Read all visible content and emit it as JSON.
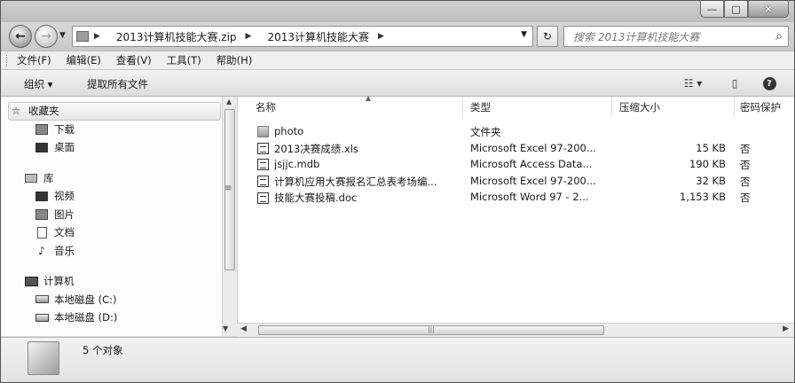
{
  "window": {
    "controls": {
      "minimize": "—",
      "maximize": "□",
      "close": "✕"
    }
  },
  "address": {
    "crumbs": [
      "2013计算机技能大赛.zip",
      "2013计算机技能大赛"
    ],
    "search_placeholder": "搜索 2013计算机技能大赛"
  },
  "menu": [
    "文件(F)",
    "编辑(E)",
    "查看(V)",
    "工具(T)",
    "帮助(H)"
  ],
  "toolbar": {
    "organize": "组织 ▾",
    "extract": "提取所有文件",
    "icons": [
      "view-options-icon",
      "preview-pane-icon",
      "help-icon"
    ]
  },
  "navigation": {
    "favorites": {
      "label": "收藏夹",
      "items": [
        "下载",
        "桌面"
      ]
    },
    "libraries": {
      "label": "库",
      "items": [
        "视频",
        "图片",
        "文档",
        "音乐"
      ]
    },
    "computer": {
      "label": "计算机",
      "items": [
        "本地磁盘 (C:)",
        "本地磁盘 (D:)"
      ]
    }
  },
  "columns": {
    "name": "名称",
    "type": "类型",
    "size": "压缩大小",
    "password": "密码保护"
  },
  "files": [
    {
      "name": "photo",
      "type": "文件夹",
      "size": "",
      "password": "",
      "icon": "folder-icon"
    },
    {
      "name": "2013决赛成绩.xls",
      "type": "Microsoft Excel 97-200...",
      "size": "15 KB",
      "password": "否",
      "icon": "excel-file-icon"
    },
    {
      "name": "jsjjc.mdb",
      "type": "Microsoft Access Data...",
      "size": "190 KB",
      "password": "否",
      "icon": "access-file-icon"
    },
    {
      "name": "计算机应用大赛报名汇总表考场编...",
      "type": "Microsoft Excel 97-200...",
      "size": "32 KB",
      "password": "否",
      "icon": "excel-file-icon"
    },
    {
      "name": "技能大赛投稿.doc",
      "type": "Microsoft Word 97 - 2...",
      "size": "1,153 KB",
      "password": "否",
      "icon": "word-file-icon"
    }
  ],
  "status": {
    "count": "5 个对象"
  }
}
